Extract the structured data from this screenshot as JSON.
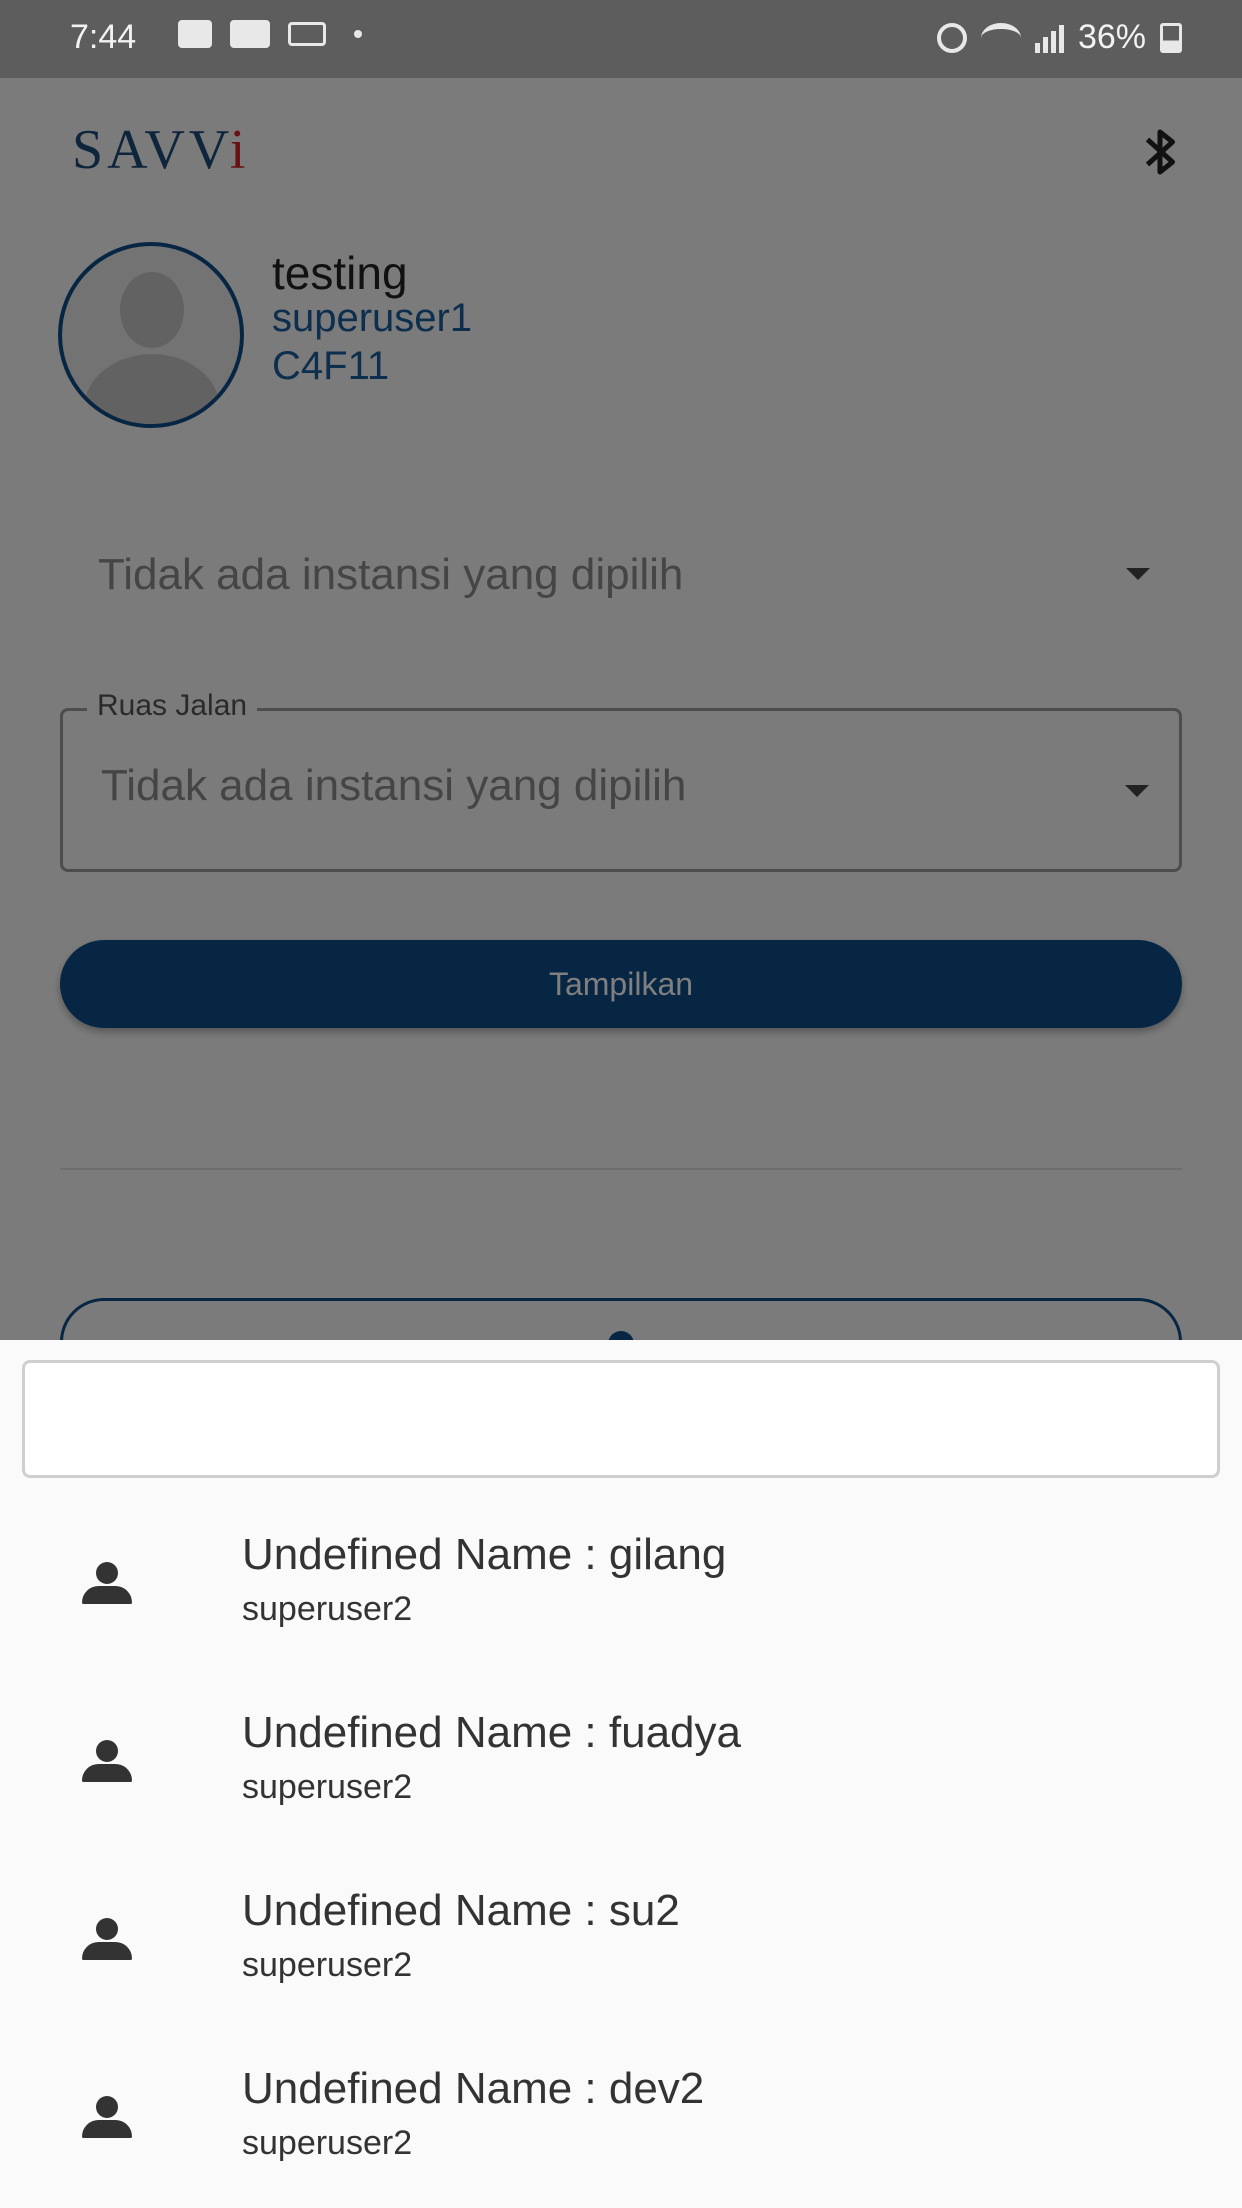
{
  "status_bar": {
    "time": "7:44",
    "battery": "36%",
    "icons": [
      "gallery-icon",
      "youtube-icon",
      "mail-icon",
      "alarm-icon",
      "wifi-icon",
      "signal-icon",
      "battery-icon"
    ]
  },
  "app": {
    "logo_main": "SAVV",
    "logo_accent": "i",
    "header_icon": "bluetooth-icon",
    "user": {
      "name": "testing",
      "role": "superuser1",
      "code": "C4F11"
    },
    "instansi_dropdown": {
      "value": "Tidak ada instansi yang dipilih"
    },
    "ruas_jalan": {
      "label": "Ruas Jalan",
      "value": "Tidak ada instansi yang dipilih"
    },
    "show_button": "Tampilkan"
  },
  "sheet": {
    "search_value": "",
    "items": [
      {
        "title": "Undefined Name : gilang",
        "subtitle": "superuser2"
      },
      {
        "title": "Undefined Name : fuadya",
        "subtitle": "superuser2"
      },
      {
        "title": "Undefined Name : su2",
        "subtitle": "superuser2"
      },
      {
        "title": "Undefined Name : dev2",
        "subtitle": "superuser2"
      }
    ]
  },
  "colors": {
    "primary": "#0e4c86",
    "accent_red": "#d0242a",
    "status_bar": "#5d5d5d"
  }
}
